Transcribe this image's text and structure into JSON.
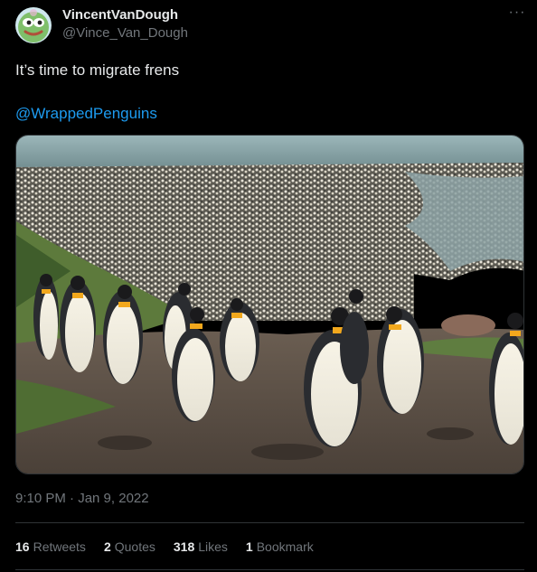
{
  "author": {
    "display_name": "VincentVanDough",
    "handle": "@Vince_Van_Dough",
    "avatar_icon": "pepe-frog-avatar-icon"
  },
  "menu": {
    "more_label": "···"
  },
  "tweet": {
    "text": "It’s time to migrate frens",
    "mention": "@WrappedPenguins",
    "media_description_icon": "penguin-colony-photo"
  },
  "meta": {
    "timestamp": "9:10 PM · Jan 9, 2022"
  },
  "stats": {
    "retweets": {
      "count": "16",
      "label": "Retweets"
    },
    "quotes": {
      "count": "2",
      "label": "Quotes"
    },
    "likes": {
      "count": "318",
      "label": "Likes"
    },
    "bookmarks": {
      "count": "1",
      "label": "Bookmark"
    }
  },
  "colors": {
    "background": "#000000",
    "text": "#e7e9ea",
    "secondary": "#71767b",
    "link": "#1d9bf0",
    "border": "#2f3336"
  }
}
